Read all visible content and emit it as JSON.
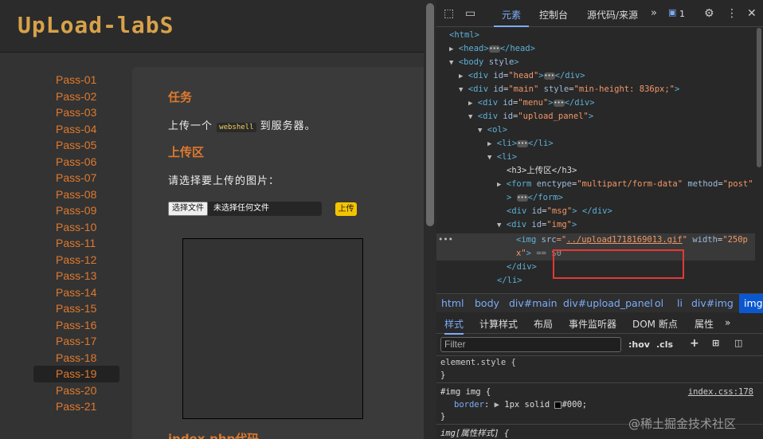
{
  "site": {
    "logo": "UpLoad-labS",
    "menu": [
      "Pass-01",
      "Pass-02",
      "Pass-03",
      "Pass-04",
      "Pass-05",
      "Pass-06",
      "Pass-07",
      "Pass-08",
      "Pass-09",
      "Pass-10",
      "Pass-11",
      "Pass-12",
      "Pass-13",
      "Pass-14",
      "Pass-15",
      "Pass-16",
      "Pass-17",
      "Pass-18",
      "Pass-19",
      "Pass-20",
      "Pass-21"
    ],
    "active": "Pass-19",
    "task_title": "任务",
    "task_pre": "上传一个",
    "task_code": "webshell",
    "task_post": "到服务器。",
    "upload_title": "上传区",
    "choose_prompt": "请选择要上传的图片：",
    "file_button": "选择文件",
    "file_status": "未选择任何文件",
    "upload_button": "上传",
    "code_title": "index.php代码"
  },
  "devtools": {
    "tabs": [
      "元素",
      "控制台",
      "源代码/来源"
    ],
    "badge": "1",
    "tree": {
      "html": "<html>",
      "head_open": "<head>",
      "head_close": "</head>",
      "body": "<body",
      "body_attr": "style",
      "body_close": ">",
      "div_head_a": "<div",
      "id": "id",
      "head_v": "\"head\"",
      "div_close": "</div>",
      "main_v": "\"main\"",
      "style": "style",
      "main_style": "\"min-height: 836px;\"",
      "menu_v": "\"menu\"",
      "panel_v": "\"upload_panel\"",
      "ol": "<ol>",
      "li": "<li>",
      "li_close": "</li>",
      "h3": "<h3>上传区</h3>",
      "form": "<form",
      "enctype": "enctype",
      "enctype_v": "\"multipart/form-data\"",
      "method": "method",
      "method_v": "\"post\"",
      "form_close": "</form>",
      "msg_v": "\"msg\"",
      "img_v": "\"img\"",
      "img_tag": "<img",
      "src": "src",
      "src_q1": "=\"",
      "src_v": "../upload1718169013.gif",
      "src_q2": "\"",
      "width": "width",
      "width_v": "\"250p",
      "width_v2": "x\"",
      "eq0": "== $0",
      "ellipsis_dots": "•••"
    },
    "breadcrumb": [
      "html",
      "body",
      "div#main",
      "div#upload_panel",
      "ol",
      "li",
      "div#img",
      "img"
    ],
    "style_tabs": [
      "样式",
      "计算样式",
      "布局",
      "事件监听器",
      "DOM 断点",
      "属性"
    ],
    "filter_placeholder": "Filter",
    "hov": ":hov",
    "cls": ".cls",
    "element_style": "element.style {",
    "close_brace": "}",
    "rule_selector": "#img img {",
    "rule_link": "index.css:178",
    "rule_prop": "border",
    "rule_val": "1px solid",
    "rule_color": "#000;",
    "attr_rule": "img[属性样式] {"
  },
  "watermark": "@稀土掘金技术社区",
  "colors": {
    "accent": "#e0792d",
    "devtools_blue": "#7cacf8",
    "highlight": "#e53935",
    "button_yellow": "#f5c400"
  }
}
